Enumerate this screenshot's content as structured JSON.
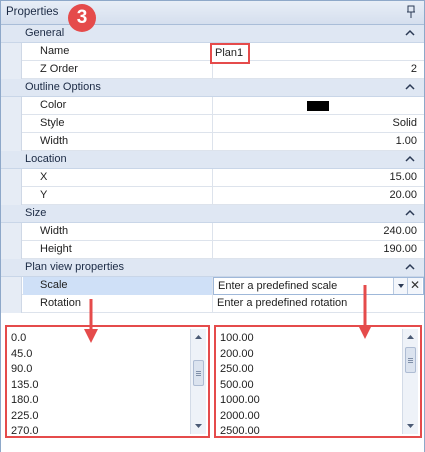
{
  "panel": {
    "title": "Properties",
    "step_badge": "3"
  },
  "categories": {
    "general": {
      "label": "General",
      "rows": {
        "name": {
          "label": "Name",
          "value": "Plan1"
        },
        "z_order": {
          "label": "Z Order",
          "value": "2"
        }
      }
    },
    "outline": {
      "label": "Outline Options",
      "rows": {
        "color": {
          "label": "Color",
          "value": "#000000"
        },
        "style": {
          "label": "Style",
          "value": "Solid"
        },
        "width": {
          "label": "Width",
          "value": "1.00"
        }
      }
    },
    "location": {
      "label": "Location",
      "rows": {
        "x": {
          "label": "X",
          "value": "15.00"
        },
        "y": {
          "label": "Y",
          "value": "20.00"
        }
      }
    },
    "size": {
      "label": "Size",
      "rows": {
        "width": {
          "label": "Width",
          "value": "240.00"
        },
        "height": {
          "label": "Height",
          "value": "190.00"
        }
      }
    },
    "plan_view": {
      "label": "Plan view properties",
      "rows": {
        "scale": {
          "label": "Scale",
          "value": "Enter a predefined scale"
        },
        "rotation": {
          "label": "Rotation",
          "value": "Enter a predefined rotation"
        }
      }
    }
  },
  "rotation_options": [
    "0.0",
    "45.0",
    "90.0",
    "135.0",
    "180.0",
    "225.0",
    "270.0"
  ],
  "scale_options": [
    "100.00",
    "200.00",
    "250.00",
    "500.00",
    "1000.00",
    "2000.00",
    "2500.00"
  ],
  "colors": {
    "accent": "#e54b4b",
    "category_bg": "#dfe7f3",
    "selection": "#cfe0f7"
  },
  "icons": {
    "pin": "pin-icon",
    "collapse": "chevron-up-icon",
    "dropdown": "chevron-down-icon",
    "clear": "close-icon"
  }
}
